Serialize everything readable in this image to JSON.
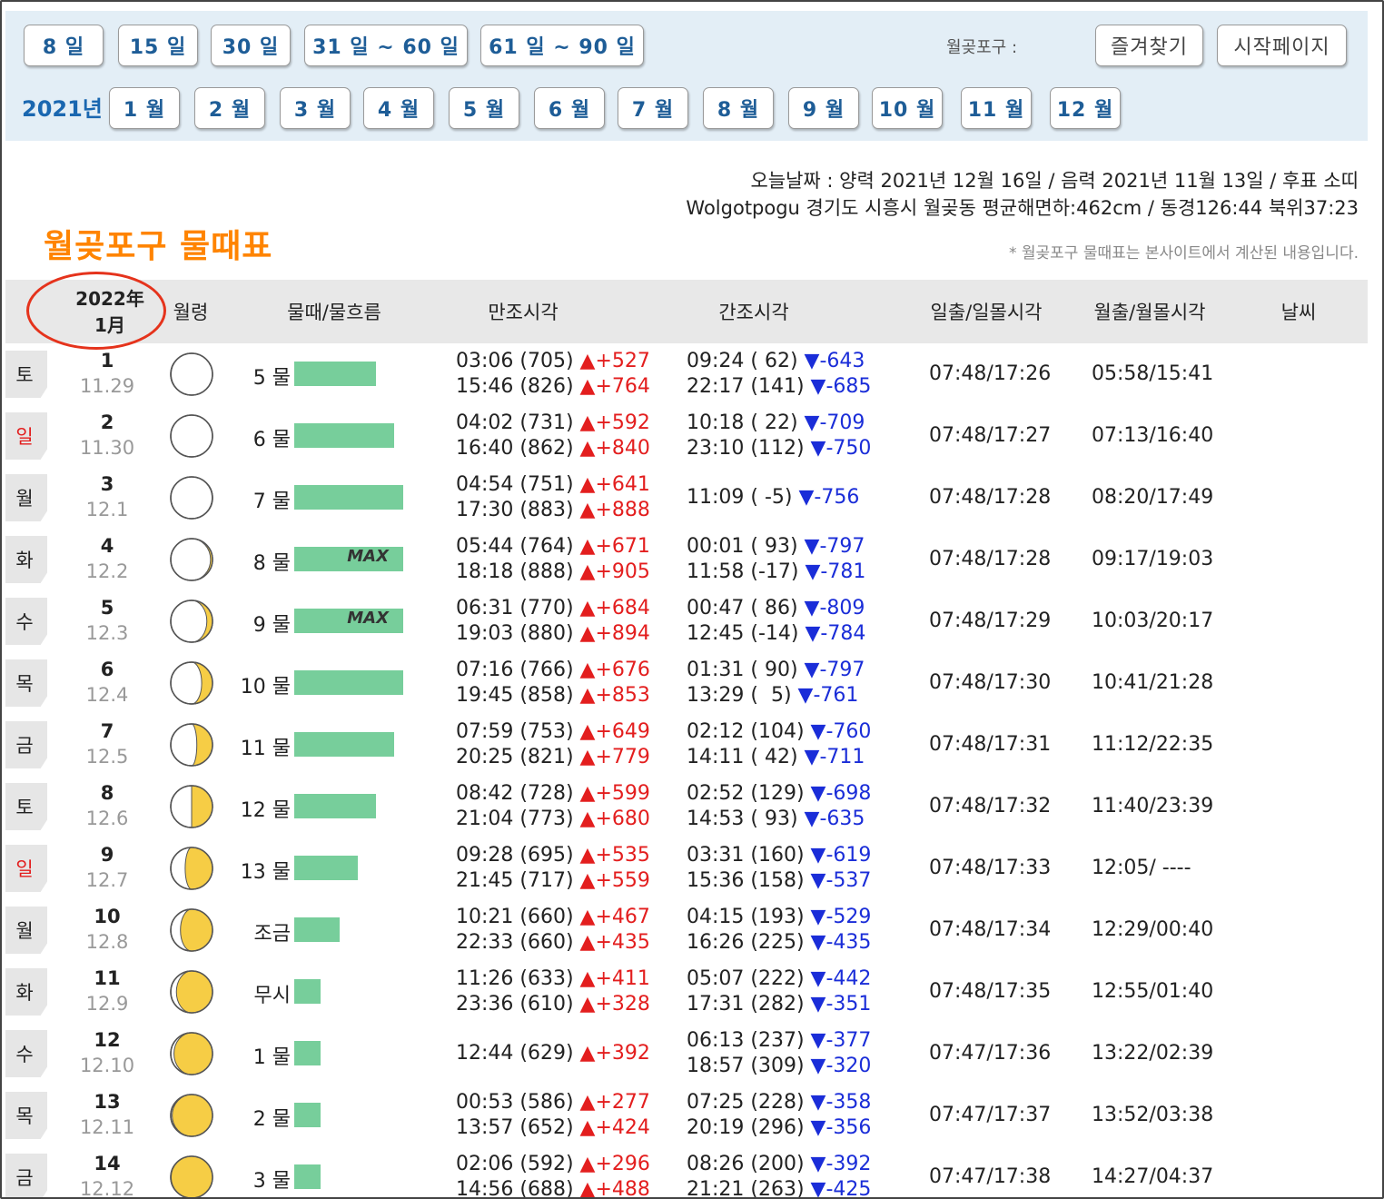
{
  "nav": {
    "range_buttons": [
      "8 일",
      "15 일",
      "30 일",
      "31 일 ~ 60 일",
      "61 일 ~ 90 일"
    ],
    "place_label": "월곶포구 :",
    "favorites_label": "즐겨찾기",
    "startpage_label": "시작페이지",
    "year_label": "2021년",
    "month_buttons": [
      "1 월",
      "2 월",
      "3 월",
      "4 월",
      "5 월",
      "6 월",
      "7 월",
      "8 월",
      "9 월",
      "10 월",
      "11 월",
      "12 월"
    ]
  },
  "info": {
    "today": "오늘날짜 : 양력 2021년 12월 16일 / 음력 2021년 11월 13일 / 후표 소띠",
    "location": "Wolgotpogu 경기도 시흥시 월곶동 평균해면하:462cm / 동경126:44 북위37:23",
    "note": "* 월곶포구 물때표는 본사이트에서 계산된 내용입니다.",
    "page_title": "월곶포구 물때표"
  },
  "table": {
    "header": {
      "year": "2022年",
      "month": "1月",
      "moon": "월령",
      "tide": "물때/물흐름",
      "high": "만조시각",
      "low": "간조시각",
      "sun": "일출/일몰시각",
      "moonrise": "월출/월몰시각",
      "weather": "날씨"
    },
    "rows": [
      {
        "dow": "토",
        "sunday": false,
        "day": "1",
        "lunar": "11.29",
        "phase": 0.97,
        "tide": "5 물",
        "bar": 0.7,
        "max": "",
        "high1": "03:06 (705) ",
        "high1d": "▲+527",
        "high2": "15:46 (826) ",
        "high2d": "▲+764",
        "low1": "09:24 ( 62) ",
        "low1d": "▼-643",
        "low2": "22:17 (141) ",
        "low2d": "▼-685",
        "sun": "07:48/17:26",
        "moon": "05:58/15:41"
      },
      {
        "dow": "일",
        "sunday": true,
        "day": "2",
        "lunar": "11.30",
        "phase": 1.0,
        "tide": "6 물",
        "bar": 0.86,
        "max": "",
        "high1": "04:02 (731) ",
        "high1d": "▲+592",
        "high2": "16:40 (862) ",
        "high2d": "▲+840",
        "low1": "10:18 ( 22) ",
        "low1d": "▼-709",
        "low2": "23:10 (112) ",
        "low2d": "▼-750",
        "sun": "07:48/17:27",
        "moon": "07:13/16:40"
      },
      {
        "dow": "월",
        "sunday": false,
        "day": "3",
        "lunar": "12.1",
        "phase": 0.03,
        "tide": "7 물",
        "bar": 0.94,
        "max": "",
        "high1": "04:54 (751) ",
        "high1d": "▲+641",
        "high2": "17:30 (883) ",
        "high2d": "▲+888",
        "low1": "11:09 ( -5) ",
        "low1d": "▼-756",
        "low2": "",
        "low2d": "",
        "sun": "07:48/17:28",
        "moon": "08:20/17:49"
      },
      {
        "dow": "화",
        "sunday": false,
        "day": "4",
        "lunar": "12.2",
        "phase": 0.07,
        "tide": "8 물",
        "bar": 0.94,
        "max": "MAX",
        "high1": "05:44 (764) ",
        "high1d": "▲+671",
        "high2": "18:18 (888) ",
        "high2d": "▲+905",
        "low1": "00:01 ( 93) ",
        "low1d": "▼-797",
        "low2": "11:58 (-17) ",
        "low2d": "▼-781",
        "sun": "07:48/17:28",
        "moon": "09:17/19:03"
      },
      {
        "dow": "수",
        "sunday": false,
        "day": "5",
        "lunar": "12.3",
        "phase": 0.12,
        "tide": "9 물",
        "bar": 0.94,
        "max": "MAX",
        "high1": "06:31 (770) ",
        "high1d": "▲+684",
        "high2": "19:03 (880) ",
        "high2d": "▲+894",
        "low1": "00:47 ( 86) ",
        "low1d": "▼-809",
        "low2": "12:45 (-14) ",
        "low2d": "▼-784",
        "sun": "07:48/17:29",
        "moon": "10:03/20:17"
      },
      {
        "dow": "목",
        "sunday": false,
        "day": "6",
        "lunar": "12.4",
        "phase": 0.17,
        "tide": "10 물",
        "bar": 0.94,
        "max": "",
        "high1": "07:16 (766) ",
        "high1d": "▲+676",
        "high2": "19:45 (858) ",
        "high2d": "▲+853",
        "low1": "01:31 ( 90) ",
        "low1d": "▼-797",
        "low2": "13:29 (  5) ",
        "low2d": "▼-761",
        "sun": "07:48/17:30",
        "moon": "10:41/21:28"
      },
      {
        "dow": "금",
        "sunday": false,
        "day": "7",
        "lunar": "12.5",
        "phase": 0.21,
        "tide": "11 물",
        "bar": 0.86,
        "max": "",
        "high1": "07:59 (753) ",
        "high1d": "▲+649",
        "high2": "20:25 (821) ",
        "high2d": "▲+779",
        "low1": "02:12 (104) ",
        "low1d": "▼-760",
        "low2": "14:11 ( 42) ",
        "low2d": "▼-711",
        "sun": "07:48/17:31",
        "moon": "11:12/22:35"
      },
      {
        "dow": "토",
        "sunday": false,
        "day": "8",
        "lunar": "12.6",
        "phase": 0.25,
        "tide": "12 물",
        "bar": 0.7,
        "max": "",
        "high1": "08:42 (728) ",
        "high1d": "▲+599",
        "high2": "21:04 (773) ",
        "high2d": "▲+680",
        "low1": "02:52 (129) ",
        "low1d": "▼-698",
        "low2": "14:53 ( 93) ",
        "low2d": "▼-635",
        "sun": "07:48/17:32",
        "moon": "11:40/23:39"
      },
      {
        "dow": "일",
        "sunday": true,
        "day": "9",
        "lunar": "12.7",
        "phase": 0.3,
        "tide": "13 물",
        "bar": 0.55,
        "max": "",
        "high1": "09:28 (695) ",
        "high1d": "▲+535",
        "high2": "21:45 (717) ",
        "high2d": "▲+559",
        "low1": "03:31 (160) ",
        "low1d": "▼-619",
        "low2": "15:36 (158) ",
        "low2d": "▼-537",
        "sun": "07:48/17:33",
        "moon": "12:05/ ----"
      },
      {
        "dow": "월",
        "sunday": false,
        "day": "10",
        "lunar": "12.8",
        "phase": 0.34,
        "tide": "조금",
        "bar": 0.39,
        "max": "",
        "high1": "10:21 (660) ",
        "high1d": "▲+467",
        "high2": "22:33 (660) ",
        "high2d": "▲+435",
        "low1": "04:15 (193) ",
        "low1d": "▼-529",
        "low2": "16:26 (225) ",
        "low2d": "▼-435",
        "sun": "07:48/17:34",
        "moon": "12:29/00:40"
      },
      {
        "dow": "화",
        "sunday": false,
        "day": "11",
        "lunar": "12.9",
        "phase": 0.38,
        "tide": "무시",
        "bar": 0.23,
        "max": "",
        "high1": "11:26 (633) ",
        "high1d": "▲+411",
        "high2": "23:36 (610) ",
        "high2d": "▲+328",
        "low1": "05:07 (222) ",
        "low1d": "▼-442",
        "low2": "17:31 (282) ",
        "low2d": "▼-351",
        "sun": "07:48/17:35",
        "moon": "12:55/01:40"
      },
      {
        "dow": "수",
        "sunday": false,
        "day": "12",
        "lunar": "12.10",
        "phase": 0.41,
        "tide": "1 물",
        "bar": 0.23,
        "max": "",
        "high1": "12:44 (629) ",
        "high1d": "▲+392",
        "high2": "",
        "high2d": "",
        "low1": "06:13 (237) ",
        "low1d": "▼-377",
        "low2": "18:57 (309) ",
        "low2d": "▼-320",
        "sun": "07:47/17:36",
        "moon": "13:22/02:39"
      },
      {
        "dow": "목",
        "sunday": false,
        "day": "13",
        "lunar": "12.11",
        "phase": 0.44,
        "tide": "2 물",
        "bar": 0.23,
        "max": "",
        "high1": "00:53 (586) ",
        "high1d": "▲+277",
        "high2": "13:57 (652) ",
        "high2d": "▲+424",
        "low1": "07:25 (228) ",
        "low1d": "▼-358",
        "low2": "20:19 (296) ",
        "low2d": "▼-356",
        "sun": "07:47/17:37",
        "moon": "13:52/03:38"
      },
      {
        "dow": "금",
        "sunday": false,
        "day": "14",
        "lunar": "12.12",
        "phase": 0.47,
        "tide": "3 물",
        "bar": 0.23,
        "max": "",
        "high1": "02:06 (592) ",
        "high1d": "▲+296",
        "high2": "14:56 (688) ",
        "high2d": "▲+488",
        "low1": "08:26 (200) ",
        "low1d": "▼-392",
        "low2": "21:21 (263) ",
        "low2d": "▼-425",
        "sun": "07:47/17:38",
        "moon": "14:27/04:37"
      }
    ]
  }
}
